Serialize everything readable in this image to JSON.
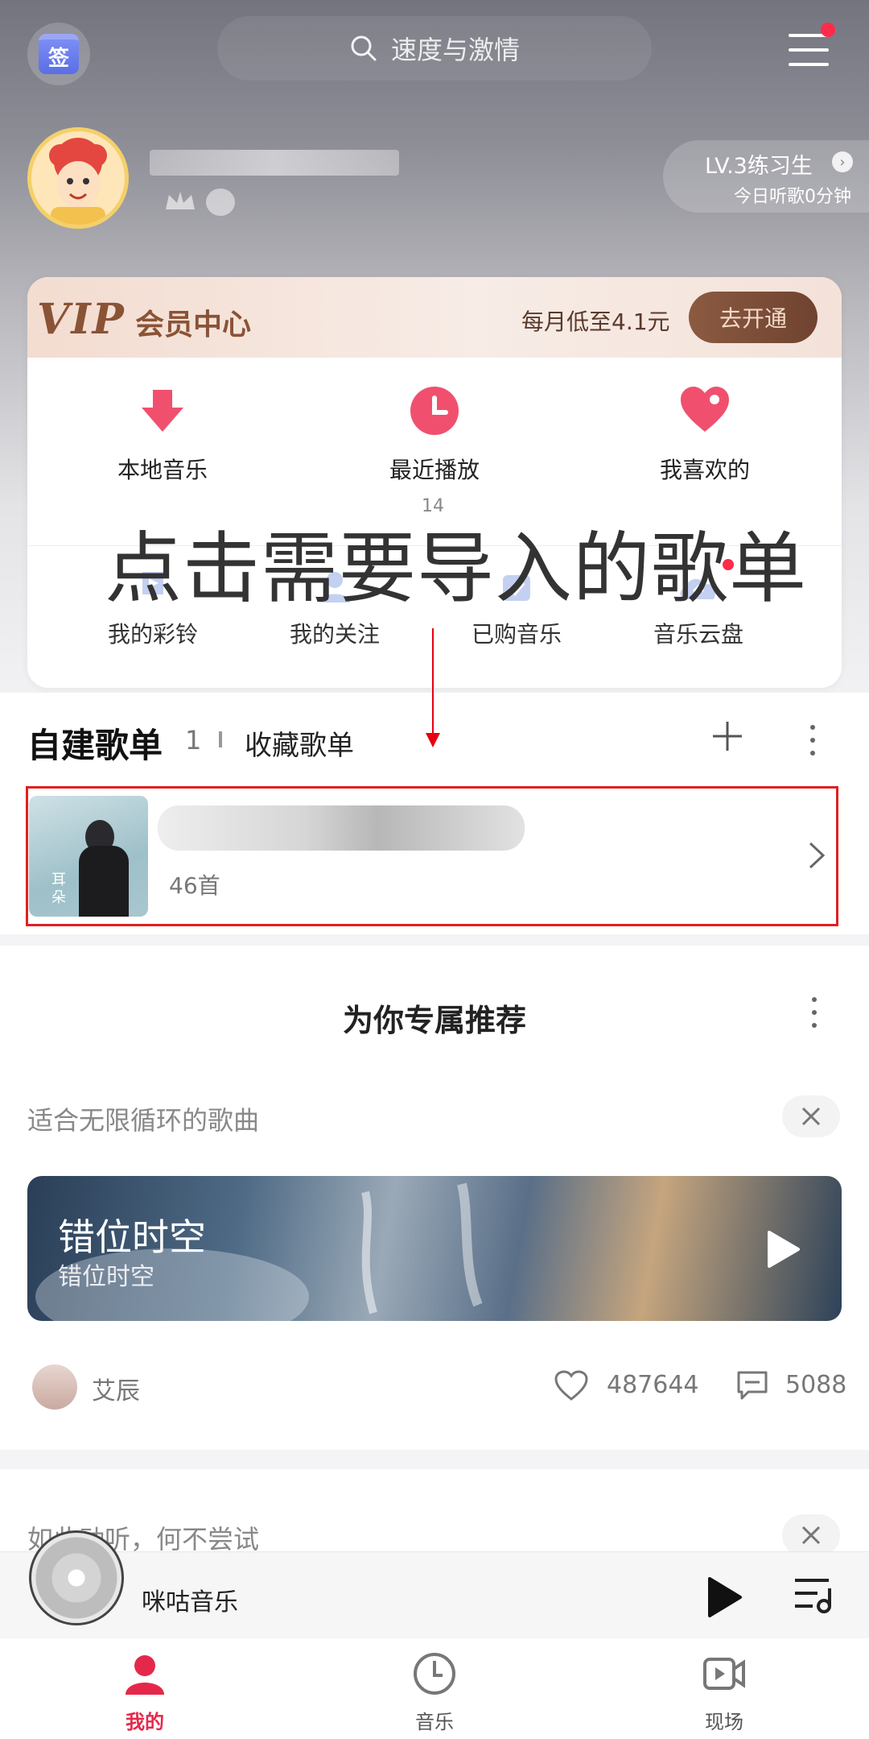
{
  "header": {
    "search_placeholder": "速度与激情",
    "sign_label": "签"
  },
  "profile": {
    "level": "LV.3练习生",
    "today_listen": "今日听歌0分钟"
  },
  "vip": {
    "logo": "VIP",
    "center": "会员中心",
    "price": "每月低至4.1元",
    "open_button": "去开通"
  },
  "quick_access": {
    "top": [
      {
        "label": "本地音乐",
        "icon": "download-arrow-icon"
      },
      {
        "label": "最近播放",
        "icon": "clock-icon"
      },
      {
        "label": "我喜欢的",
        "icon": "heart-icon"
      }
    ],
    "badge": "14",
    "bottom": [
      {
        "label": "我的彩铃",
        "icon": "ringtone-icon"
      },
      {
        "label": "我的关注",
        "icon": "person-icon"
      },
      {
        "label": "已购音乐",
        "icon": "purchased-icon"
      },
      {
        "label": "音乐云盘",
        "icon": "cloud-upload-icon"
      }
    ]
  },
  "overlay": {
    "instruction": "点击需要导入的歌单"
  },
  "playlists": {
    "title": "自建歌单",
    "count": "1",
    "favorites_tab": "收藏歌单",
    "items": [
      {
        "count": "46首",
        "cover_text": "耳朵"
      }
    ]
  },
  "recommend": {
    "title": "为你专属推荐",
    "section1": {
      "subtitle": "适合无限循环的歌曲",
      "banner_title": "错位时空",
      "banner_sub": "错位时空",
      "artist": "艾辰",
      "likes": "487644",
      "comments": "5088"
    },
    "section2": {
      "subtitle": "如此动听，何不尝试"
    }
  },
  "mini_player": {
    "title": "咪咕音乐"
  },
  "nav": {
    "tabs": [
      {
        "label": "我的",
        "active": true
      },
      {
        "label": "音乐",
        "active": false
      },
      {
        "label": "现场",
        "active": false
      }
    ]
  },
  "colors": {
    "accent": "#e5284a",
    "vip_brown": "#8a5336",
    "highlight_box": "#e02020"
  }
}
